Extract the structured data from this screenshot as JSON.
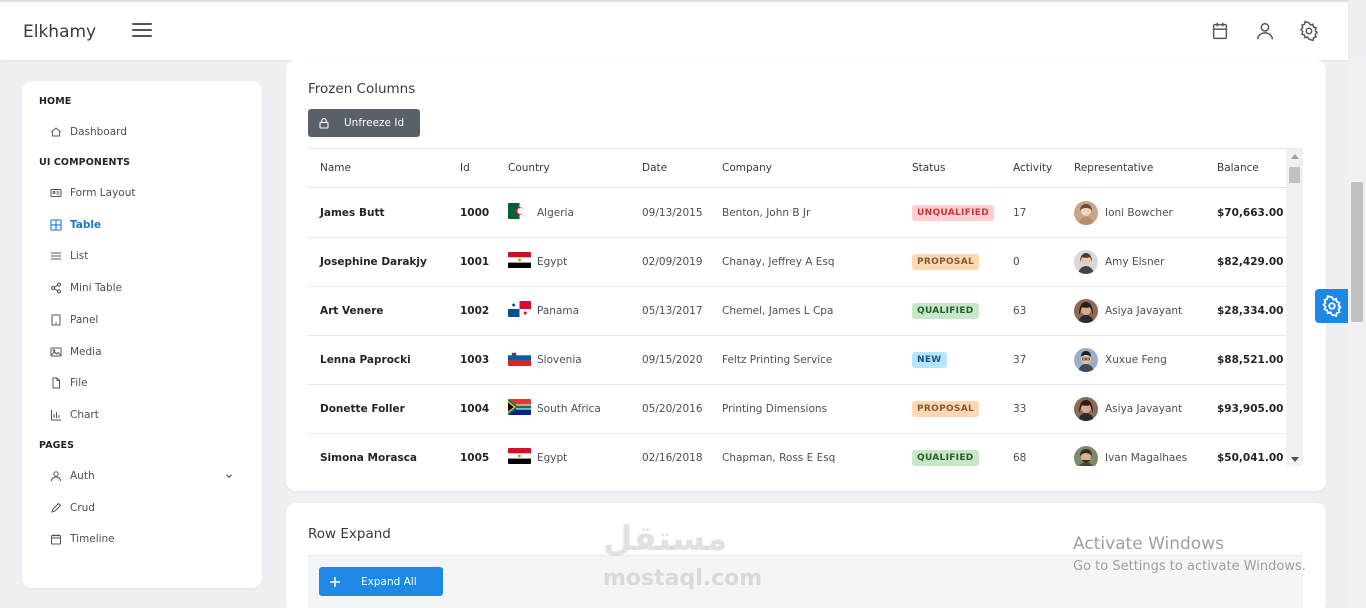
{
  "app": {
    "title": "Elkhamy"
  },
  "sidebar": {
    "sections": [
      {
        "label": "HOME",
        "items": [
          {
            "label": "Dashboard",
            "icon": "home-icon"
          }
        ]
      },
      {
        "label": "UI COMPONENTS",
        "items": [
          {
            "label": "Form Layout",
            "icon": "id-card-icon"
          },
          {
            "label": "Table",
            "icon": "table-icon",
            "active": true
          },
          {
            "label": "List",
            "icon": "list-icon"
          },
          {
            "label": "Mini Table",
            "icon": "share-icon"
          },
          {
            "label": "Panel",
            "icon": "tablet-icon"
          },
          {
            "label": "Media",
            "icon": "image-icon"
          },
          {
            "label": "File",
            "icon": "file-icon"
          },
          {
            "label": "Chart",
            "icon": "chart-bar-icon"
          }
        ]
      },
      {
        "label": "PAGES",
        "items": [
          {
            "label": "Auth",
            "icon": "user-icon"
          },
          {
            "label": "Crud",
            "icon": "pencil-icon"
          },
          {
            "label": "Timeline",
            "icon": "calendar-icon"
          }
        ]
      }
    ]
  },
  "frozen": {
    "title": "Frozen Columns",
    "button_label": "Unfreeze Id",
    "columns": [
      "Name",
      "Id",
      "Country",
      "Date",
      "Company",
      "Status",
      "Activity",
      "Representative",
      "Balance"
    ],
    "rows": [
      {
        "name": "James Butt",
        "id": "1000",
        "country": "Algeria",
        "date": "09/13/2015",
        "company": "Benton, John B Jr",
        "status": "UNQUALIFIED",
        "activity": "17",
        "rep": "Ioni Bowcher",
        "balance": "$70,663.00"
      },
      {
        "name": "Josephine Darakjy",
        "id": "1001",
        "country": "Egypt",
        "date": "02/09/2019",
        "company": "Chanay, Jeffrey A Esq",
        "status": "PROPOSAL",
        "activity": "0",
        "rep": "Amy Elsner",
        "balance": "$82,429.00"
      },
      {
        "name": "Art Venere",
        "id": "1002",
        "country": "Panama",
        "date": "05/13/2017",
        "company": "Chemel, James L Cpa",
        "status": "QUALIFIED",
        "activity": "63",
        "rep": "Asiya Javayant",
        "balance": "$28,334.00"
      },
      {
        "name": "Lenna Paprocki",
        "id": "1003",
        "country": "Slovenia",
        "date": "09/15/2020",
        "company": "Feltz Printing Service",
        "status": "NEW",
        "activity": "37",
        "rep": "Xuxue Feng",
        "balance": "$88,521.00"
      },
      {
        "name": "Donette Foller",
        "id": "1004",
        "country": "South Africa",
        "date": "05/20/2016",
        "company": "Printing Dimensions",
        "status": "PROPOSAL",
        "activity": "33",
        "rep": "Asiya Javayant",
        "balance": "$93,905.00"
      },
      {
        "name": "Simona Morasca",
        "id": "1005",
        "country": "Egypt",
        "date": "02/16/2018",
        "company": "Chapman, Ross E Esq",
        "status": "QUALIFIED",
        "activity": "68",
        "rep": "Ivan Magalhaes",
        "balance": "$50,041.00"
      }
    ]
  },
  "row_expand": {
    "title": "Row Expand",
    "button_label": "Expand All"
  },
  "watermark": {
    "arabic": "مستقل",
    "latin": "mostaql.com"
  },
  "activation": {
    "title": "Activate Windows",
    "subtitle": "Go to Settings to activate Windows."
  },
  "colors": {
    "accent": "#1e88e5",
    "unqualified_bg": "#ffcdd2",
    "unqualified_fg": "#c63737",
    "proposal_bg": "#ffd8b2",
    "proposal_fg": "#805b36",
    "qualified_bg": "#c8e6c9",
    "qualified_fg": "#256029",
    "new_bg": "#b3e5fc",
    "new_fg": "#23547b"
  }
}
